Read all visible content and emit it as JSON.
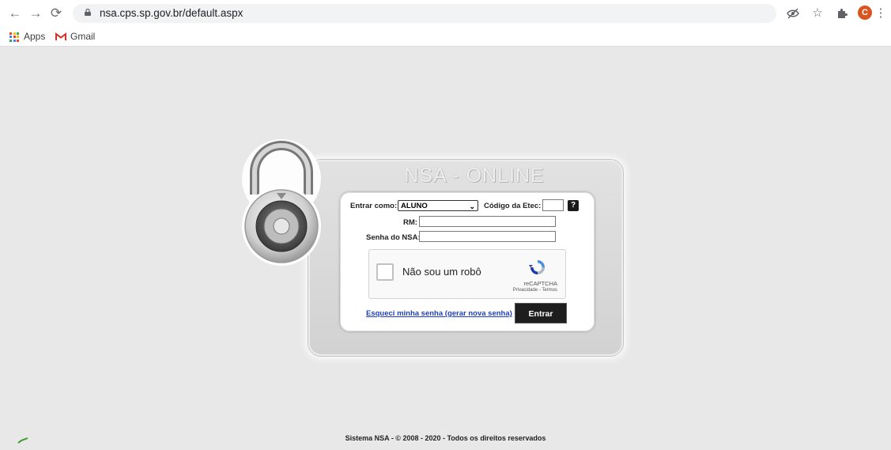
{
  "browser": {
    "url": "nsa.cps.sp.gov.br/default.aspx",
    "profile_initial": "C",
    "bookmarks": [
      "Apps",
      "Gmail"
    ]
  },
  "login": {
    "title": "NSA - ONLINE",
    "enter_as_label": "Entrar como:",
    "enter_as_value": "ALUNO",
    "etec_code_label": "Código da Etec:",
    "help_label": "?",
    "rm_label": "RM:",
    "password_label": "Senha do NSA:",
    "captcha_text": "Não sou um robô",
    "captcha_brand": "reCAPTCHA",
    "captcha_links": "Privacidade - Termos",
    "forgot_link": "Esqueci minha senha (gerar nova senha)",
    "submit_label": "Entrar"
  },
  "footer": {
    "text": "Sistema NSA  -  © 2008 - 2020  -  Todos os direitos reservados"
  },
  "colors": {
    "page_bg": "#e8e8e8",
    "button_bg": "#1e1e1e",
    "link": "#1f3fbf",
    "profile": "#d9541e"
  }
}
